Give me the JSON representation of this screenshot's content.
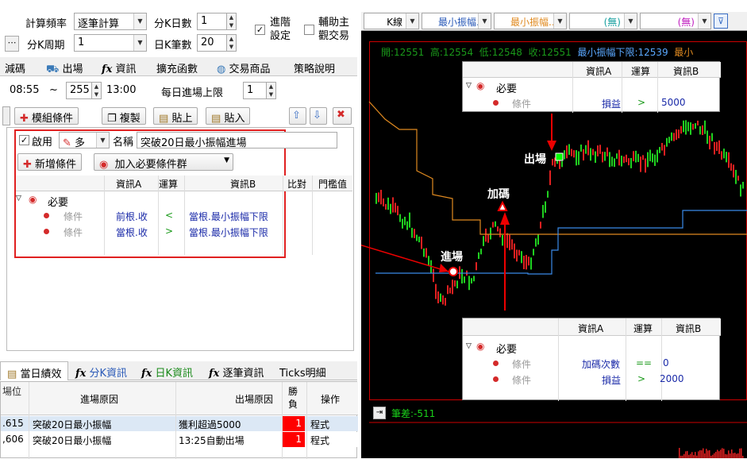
{
  "settings": {
    "calc_freq_label": "計算頻率",
    "calc_freq_value": "逐筆計算",
    "k_period_label": "分K周期",
    "k_period_value": "1",
    "min_k_days_label": "分K日數",
    "min_k_days_value": "1",
    "day_k_count_label": "日K筆數",
    "day_k_count_value": "20",
    "advanced_label": "進階\n設定",
    "advanced_checked": "✓",
    "aux_label": "輔助主\n觀交易"
  },
  "tabs": [
    "減碼",
    "出場",
    "資訊",
    "擴充函數",
    "交易商品",
    "策略說明"
  ],
  "time": {
    "start": "08:55",
    "tilde": "~",
    "end_value": "255",
    "end": "13:00",
    "daily_limit_label": "每日進場上限",
    "daily_limit_value": "1"
  },
  "toolbar": {
    "module_cond": "模組條件",
    "copy": "複製",
    "paste": "貼上",
    "import": "貼入"
  },
  "condition": {
    "enable_label": "啟用",
    "direction": "多",
    "name_label": "名稱",
    "name_value": "突破20日最小振幅進場",
    "add_cond": "新增條件",
    "add_required_group": "加入必要條件群",
    "headers": [
      "資訊A",
      "運算",
      "資訊B",
      "比對",
      "門檻值"
    ],
    "group_label": "必要",
    "rows": [
      {
        "label": "條件",
        "a": "前根.收",
        "op": "<",
        "b": "當根.最小振幅下限"
      },
      {
        "label": "條件",
        "a": "當根.收",
        "op": ">",
        "b": "當根.最小振幅下限"
      }
    ]
  },
  "bottom_tabs": [
    "當日績效",
    "分K資訊",
    "日K資訊",
    "逐筆資訊",
    "Ticks明細"
  ],
  "perf_table": {
    "headers": [
      "場位",
      "進場原因",
      "出場原因",
      "勝負",
      "操作"
    ],
    "rows": [
      {
        "pos": ".615",
        "entry": "突破20日最小振幅",
        "exit": "獲利超過5000",
        "win": "1",
        "op": "程式"
      },
      {
        "pos": ",606",
        "entry": "突破20日最小振幅",
        "exit": "13:25自動出場",
        "win": "1",
        "op": "程式"
      }
    ]
  },
  "chart": {
    "selects": [
      "K線",
      "最小振幅...",
      "最小振幅...",
      "(無)",
      "(無)"
    ],
    "ohlc": {
      "open": "開:12551",
      "high": "高:12554",
      "low": "低:12548",
      "close": "收:12551",
      "lower": "最小振幅下限:12539",
      "more": "最小"
    },
    "label_entry": "進場",
    "label_add": "加碼",
    "label_exit": "出場",
    "diff": "筆差:-511"
  },
  "popup_exit": {
    "headers": [
      "資訊A",
      "運算",
      "資訊B"
    ],
    "group": "必要",
    "rows": [
      {
        "label": "條件",
        "a": "損益",
        "op": ">",
        "b": "5000"
      }
    ]
  },
  "popup_add": {
    "headers": [
      "資訊A",
      "運算",
      "資訊B"
    ],
    "group": "必要",
    "rows": [
      {
        "label": "條件",
        "a": "加碼次數",
        "op": "==",
        "b": "0"
      },
      {
        "label": "條件",
        "a": "損益",
        "op": ">",
        "b": "2000"
      }
    ]
  }
}
